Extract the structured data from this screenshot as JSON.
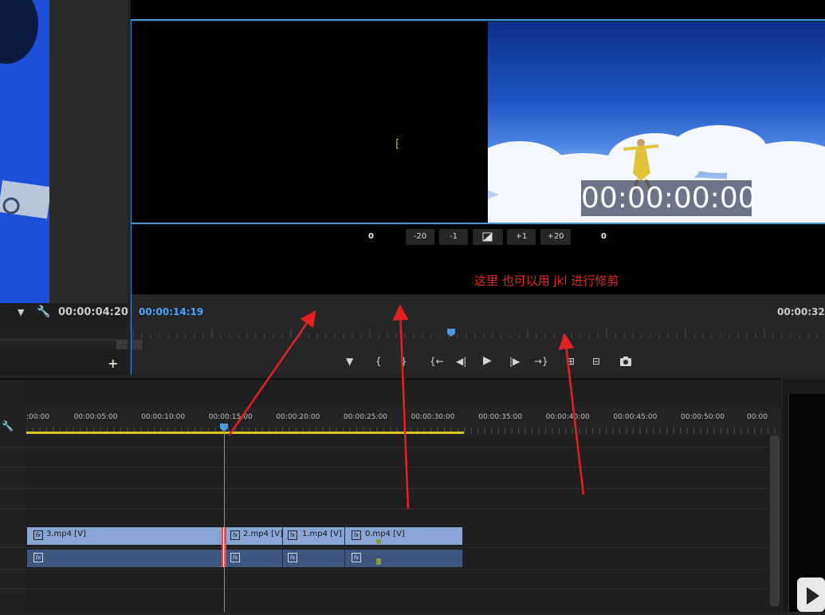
{
  "source": {
    "timecode": "00:00:04:20",
    "dropdown_icon": "chevron-down-icon",
    "wrench_icon": "wrench-icon",
    "add_label": "+"
  },
  "program": {
    "timecode_current": "00:00:14:19",
    "timecode_duration": "00:00:32:",
    "overlay_timecode": "00:00:00:00",
    "trim": {
      "left_value": "0",
      "right_value": "0",
      "buttons": [
        "-20",
        "-1",
        "+1",
        "+20"
      ]
    },
    "annotation": "这里 也可以用 jkl 进行修剪",
    "controls": {
      "marker": "▼",
      "in_point": "{",
      "out_point": "}",
      "go_in": "{←",
      "step_back": "◀|",
      "play": "▶",
      "step_forward": "|▶",
      "go_out": "→}",
      "insert": "⊞",
      "overwrite": "⊟",
      "export_frame": "📷"
    }
  },
  "timeline": {
    "ruler_labels": [
      ":00:00",
      "00:00:05:00",
      "00:00:10:00",
      "00:00:15:00",
      "00:00:20:00",
      "00:00:25:00",
      "00:00:30:00",
      "00:00:35:00",
      "00:00:40:00",
      "00:00:45:00",
      "00:00:50:00",
      "00:00"
    ],
    "video_clips": [
      {
        "name": "3.mp4 [V]"
      },
      {
        "name": "2.mp4 [V]"
      },
      {
        "name": "1.mp4 [V]"
      },
      {
        "name": "0.mp4 [V]"
      }
    ],
    "fx_label": "fx"
  }
}
